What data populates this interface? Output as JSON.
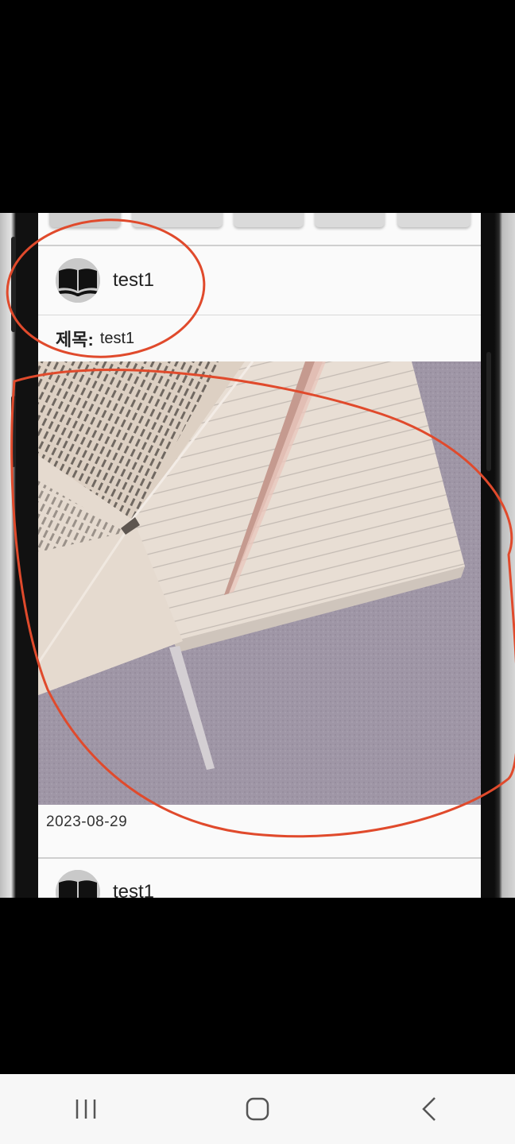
{
  "tabs": [
    "",
    "",
    "",
    "",
    ""
  ],
  "posts": [
    {
      "username": "test1",
      "title_label": "제목:",
      "title_value": "test1",
      "date": "2023-08-29"
    },
    {
      "username": "test1"
    }
  ],
  "icons": {
    "avatar": "open-book-icon",
    "nav_recent": "recent-apps-icon",
    "nav_home": "home-icon",
    "nav_back": "back-icon"
  },
  "colors": {
    "annotation": "#e04a2c",
    "navbar": "#f7f7f7",
    "screen_bg": "#fafafa"
  }
}
